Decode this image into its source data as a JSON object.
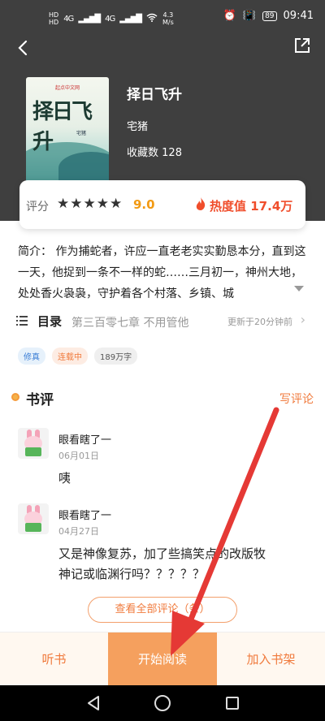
{
  "status_bar": {
    "sim1": "HD",
    "sim2": "HD",
    "net1": "4G",
    "net2": "4G",
    "speed": "4.3",
    "speed_unit": "M/s",
    "battery": "89",
    "time": "09:41"
  },
  "book": {
    "cover_title": "择日飞升",
    "cover_publisher": "起点中文网",
    "cover_author": "宅猪",
    "title": "择日飞升",
    "author": "宅猪",
    "favorites_label": "收藏数",
    "favorites_count": "128"
  },
  "rating": {
    "label": "评分",
    "stars": "★★★★★",
    "score": "9.0",
    "score_value": 9.0,
    "heat_label": "热度值",
    "heat_value": "17.4万"
  },
  "intro": {
    "label": "简介：",
    "text": "作为捕蛇者，许应一直老老实实勤恳本分，直到这一天，他捉到一条不一样的蛇……三月初一，神州大地，处处香火袅袅，守护着各个村落、乡镇、城"
  },
  "toc": {
    "label": "目录",
    "latest_chapter": "第三百零七章 不用管他",
    "updated": "更新于20分钟前"
  },
  "tags": [
    "修真",
    "连载中",
    "189万字"
  ],
  "reviews_section": {
    "title": "书评",
    "write_label": "写评论",
    "view_all_label": "查看全部评论（条）",
    "items": [
      {
        "user": "眼看瞎了一",
        "date": "06月01日",
        "text": "咦"
      },
      {
        "user": "眼看瞎了一",
        "date": "04月27日",
        "text": "又是神像复苏，加了些搞笑点的改版牧神记或临渊行吗？？？？？"
      }
    ]
  },
  "bottom_bar": {
    "listen_label": "听书",
    "read_label": "开始阅读",
    "shelf_label": "加入书架"
  },
  "colors": {
    "header_bg": "#3f3f3f",
    "accent_orange": "#f07a3c",
    "read_button": "#f5a05e",
    "score": "#f29a13",
    "heat": "#f04e2c",
    "annotation_arrow": "#e53935"
  },
  "icons": {
    "back": "back-arrow-icon",
    "share": "share-icon",
    "fire": "fire-icon",
    "toc": "list-icon",
    "chevron": "chevron-right-icon",
    "review_dot": "dot-icon"
  }
}
